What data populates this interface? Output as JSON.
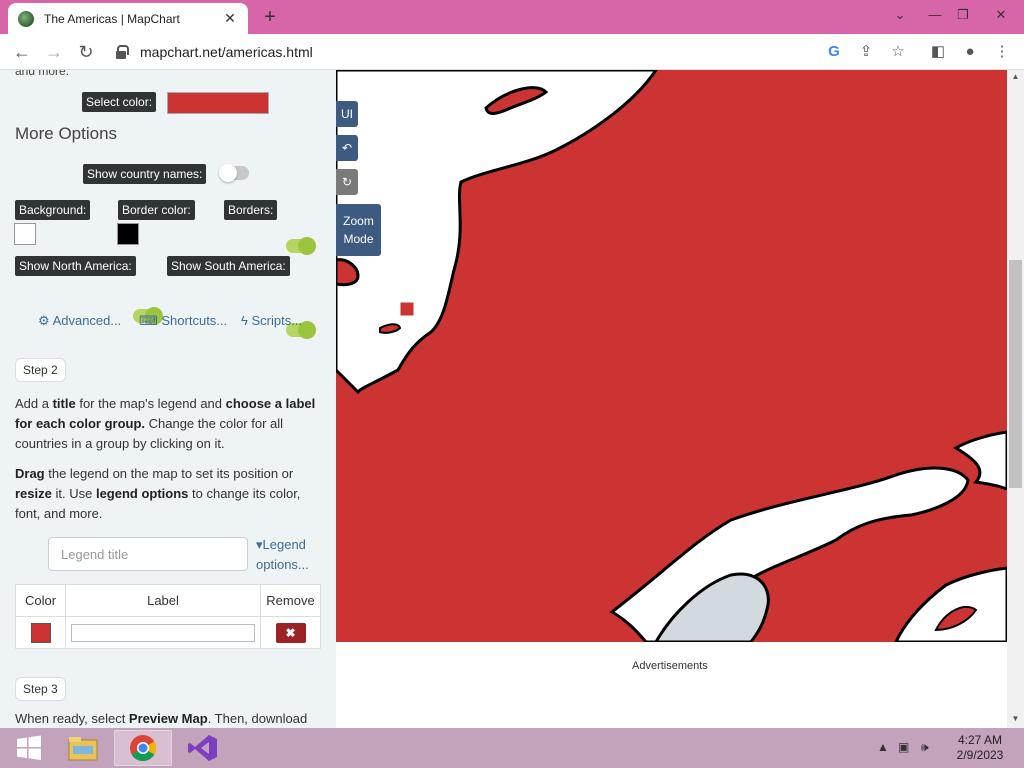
{
  "browser": {
    "tab_title": "The Americas | MapChart",
    "new_tab": "+",
    "url": "mapchart.net/americas.html",
    "window": {
      "minimize": "—",
      "restore": "❐",
      "close": "✕",
      "tabsearch": "⌄"
    }
  },
  "panel": {
    "clipped_text": "and more.",
    "select_color_label": "Select color:",
    "select_color_value": "#cc3333",
    "more_options_heading": "More Options",
    "show_country_names_label": "Show country names:",
    "show_country_names": false,
    "background_label": "Background:",
    "background_color": "#ffffff",
    "border_color_label": "Border color:",
    "border_color": "#000000",
    "borders_label": "Borders:",
    "borders": true,
    "show_north_america_label": "Show North America:",
    "show_north_america": true,
    "show_south_america_label": "Show South America:",
    "show_south_america": true,
    "advanced_link": "Advanced...",
    "shortcuts_link": "Shortcuts...",
    "scripts_link": "Scripts...",
    "step2_label": "Step 2",
    "step2_para1": [
      {
        "t": "Add a ",
        "b": false
      },
      {
        "t": "title",
        "b": true
      },
      {
        "t": " for the map's legend and ",
        "b": false
      },
      {
        "t": "choose a label for each color group.",
        "b": true
      },
      {
        "t": " Change the color for all countries in a group by clicking on it.",
        "b": false
      }
    ],
    "step2_para2": [
      {
        "t": "Drag",
        "b": true
      },
      {
        "t": " the legend on the map to set its position or ",
        "b": false
      },
      {
        "t": "resize",
        "b": true
      },
      {
        "t": " it. Use ",
        "b": false
      },
      {
        "t": "legend options",
        "b": true
      },
      {
        "t": " to change its color, font, and more.",
        "b": false
      }
    ],
    "legend_title_placeholder": "Legend title",
    "legend_options_link": "Legend options...",
    "legend_table": {
      "headers": [
        "Color",
        "Label",
        "Remove"
      ],
      "rows": [
        {
          "color": "#cc3333",
          "label": ""
        }
      ]
    },
    "step3_label": "Step 3",
    "step3_para": [
      {
        "t": "When ready, select ",
        "b": false
      },
      {
        "t": "Preview Map",
        "b": true
      },
      {
        "t": ". Then, download",
        "b": false
      }
    ]
  },
  "map": {
    "fill_color": "#cc3333",
    "water_color": "#ffffff",
    "lake_color": "#d3dadf",
    "buttons": {
      "ui": "UI",
      "undo": "↶",
      "redo": "↻",
      "zoom_mode": "Zoom Mode"
    },
    "ads_label": "Advertisements"
  },
  "taskbar": {
    "time": "4:27 AM",
    "date": "2/9/2023",
    "apps": [
      "file-explorer",
      "chrome",
      "visual-studio"
    ]
  }
}
